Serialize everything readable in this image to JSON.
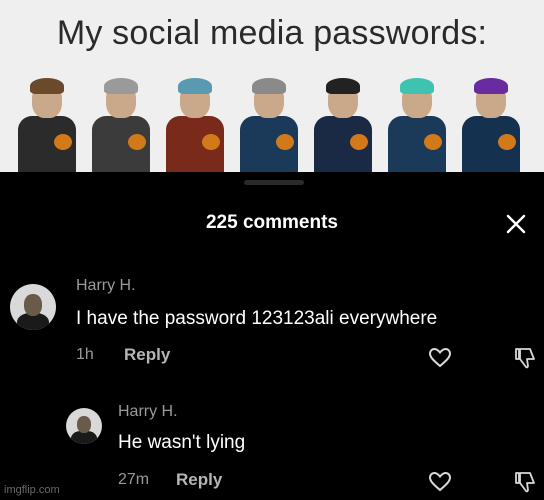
{
  "meme": {
    "title": "My social media passwords:"
  },
  "sheet": {
    "comment_count_label": "225 comments"
  },
  "comments": [
    {
      "author": "Harry H.",
      "text": "I have the password 123123ali everywhere",
      "time": "1h",
      "reply_label": "Reply"
    },
    {
      "author": "Harry H.",
      "text": "He wasn't lying",
      "time": "27m",
      "reply_label": "Reply"
    }
  ],
  "watermark": "imgflip.com",
  "colors": {
    "background": "#000000",
    "meme_background": "#efefef",
    "secondary_text": "#9a9a9a"
  }
}
